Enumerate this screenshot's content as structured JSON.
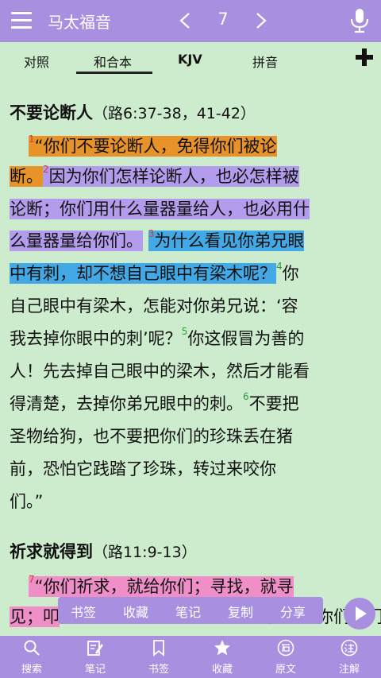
{
  "header": {
    "title": "马太福音",
    "chapter": "7",
    "menu_icon": "hamburger-menu-icon",
    "prev_icon": "chevron-left-icon",
    "next_icon": "chevron-right-icon",
    "mic_icon": "microphone-icon"
  },
  "tabs": [
    {
      "label": "对照"
    },
    {
      "label": "和合本",
      "active": true
    },
    {
      "label": "KJV"
    },
    {
      "label": "拼音"
    }
  ],
  "add_icon": "plus-icon",
  "sections": [
    {
      "title": "不要论断人",
      "ref": "（路6:37-38，41-42）"
    },
    {
      "title": "祈求就得到",
      "ref": "（路11:9-13）"
    }
  ],
  "verse_numbers": [
    "1",
    "2",
    "3",
    "4",
    "5",
    "6",
    "7"
  ],
  "lines": [
    "“你们不要论断人，免得你们被论",
    "断。",
    "因为你们怎样论断人，也必怎样被",
    "论断；你们用什么量器量给人，也必用什",
    "么量器量给你们。",
    "为什么看见你弟兄眼",
    "中有刺，却不想自己眼中有梁木呢？",
    "你",
    "自己眼中有梁木，怎能对你弟兄说：‘容",
    "我去掉你眼中的刺’呢？",
    "你这假冒为善的",
    "人！先去掉自己眼中的梁木，然后才能看",
    "得清楚，去掉你弟兄眼中的刺。",
    "不要把",
    "圣物给狗，也不要把你们的珍珠丢在猪",
    "前，恐怕它践踏了珍珠，转过来咬你",
    "们。”",
    "“你们祈求，就给你们；寻找，就寻",
    "见；叩",
    "门，就给你们开门"
  ],
  "highlight_colors": {
    "orange": "#e8922a",
    "purple": "#b49cec",
    "blue": "#43a9e6",
    "pink": "#f08ec8"
  },
  "action_menu": [
    "书签",
    "收藏",
    "笔记",
    "复制",
    "分享"
  ],
  "play_icon": "play-icon",
  "bottom_nav": [
    {
      "label": "搜索",
      "icon": "search-icon"
    },
    {
      "label": "笔记",
      "icon": "note-edit-icon"
    },
    {
      "label": "书签",
      "icon": "bookmark-icon"
    },
    {
      "label": "收藏",
      "icon": "star-icon"
    },
    {
      "label": "原文",
      "icon": "original-text-icon"
    },
    {
      "label": "注解",
      "icon": "annotation-icon"
    }
  ],
  "colors": {
    "accent": "#a98fe0",
    "background": "#cdeccd"
  }
}
